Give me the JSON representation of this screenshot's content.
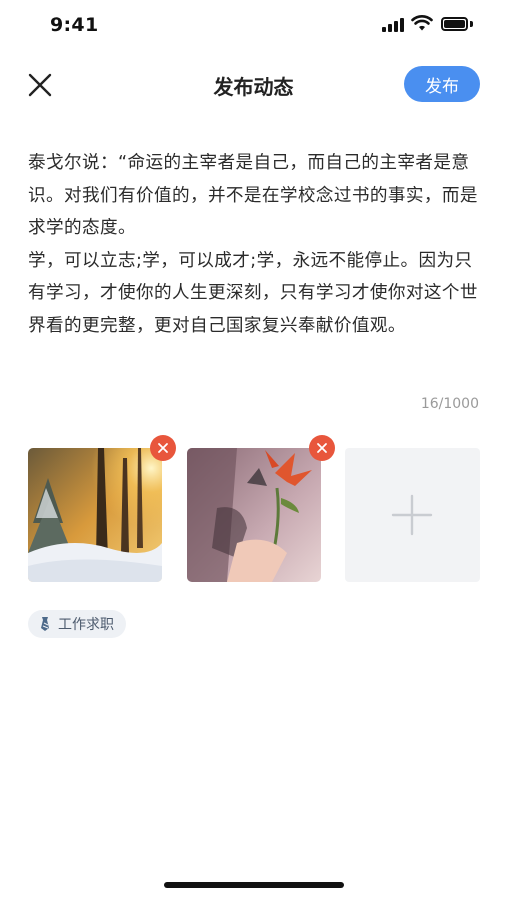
{
  "status_bar": {
    "time": "9:41"
  },
  "nav": {
    "title": "发布动态",
    "publish_label": "发布",
    "accent_color": "#4a8ff0"
  },
  "post": {
    "text": "泰戈尔说：“命运的主宰者是自己，而自己的主宰者是意识。对我们有价值的，并不是在学校念过书的事实，而是求学的态度。\n学，可以立志;学，可以成才;学，永远不能停止。因为只有学习，才使你的人生更深刻，只有学习才使你对这个世界看的更完整，更对自己国家复兴奉献价值观。",
    "char_count": "16/1000"
  },
  "images": [
    {
      "name": "snowy-forest-sunset-photo",
      "removable": true
    },
    {
      "name": "lily-flower-photo",
      "removable": true
    }
  ],
  "add_image_icon": "plus-icon",
  "remove_color": "#e8563c",
  "tag": {
    "icon": "tie-icon",
    "label": "工作求职"
  }
}
